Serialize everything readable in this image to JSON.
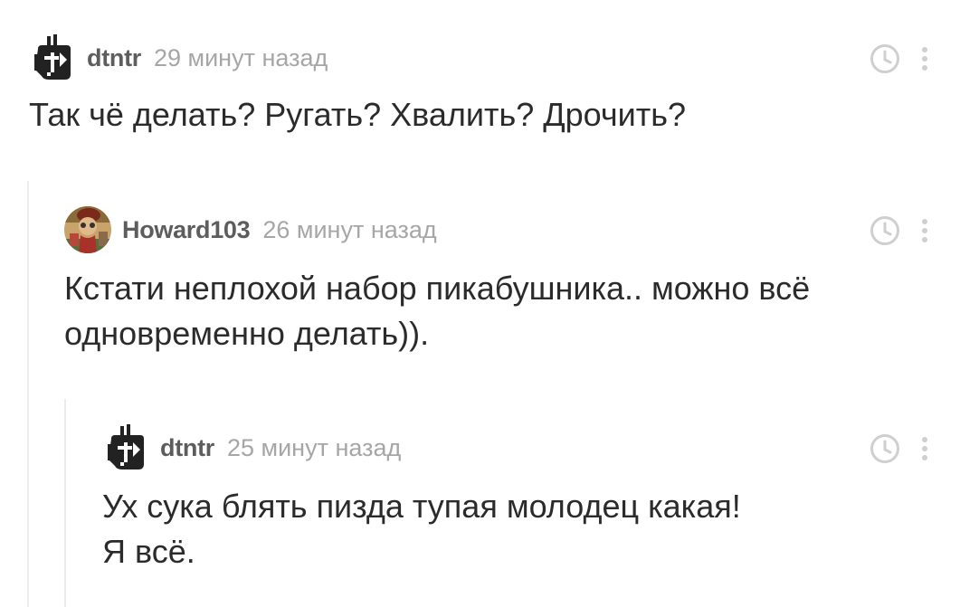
{
  "comments": [
    {
      "username": "dtntr",
      "time": "29 минут назад",
      "text": "Так чё делать? Ругать? Хвалить? Дрочить?",
      "avatar": "robot-avatar"
    },
    {
      "username": "Howard103",
      "time": "26 минут назад",
      "text": "Кстати неплохой набор пикабушника.. можно всё\nодновременно делать)).",
      "avatar": "photo-avatar"
    },
    {
      "username": "dtntr",
      "time": "25 минут назад",
      "text": "Ух сука блять пизда тупая молодец какая!\nЯ всё.",
      "avatar": "robot-avatar"
    }
  ],
  "icons": {
    "clock": "clock-icon",
    "more": "more-vertical-icon"
  },
  "colors": {
    "username": "#5d5d5d",
    "time": "#a6a6a6",
    "text": "#2b2b2b",
    "icon": "#cfcfcf",
    "thread_line": "#ececec"
  }
}
